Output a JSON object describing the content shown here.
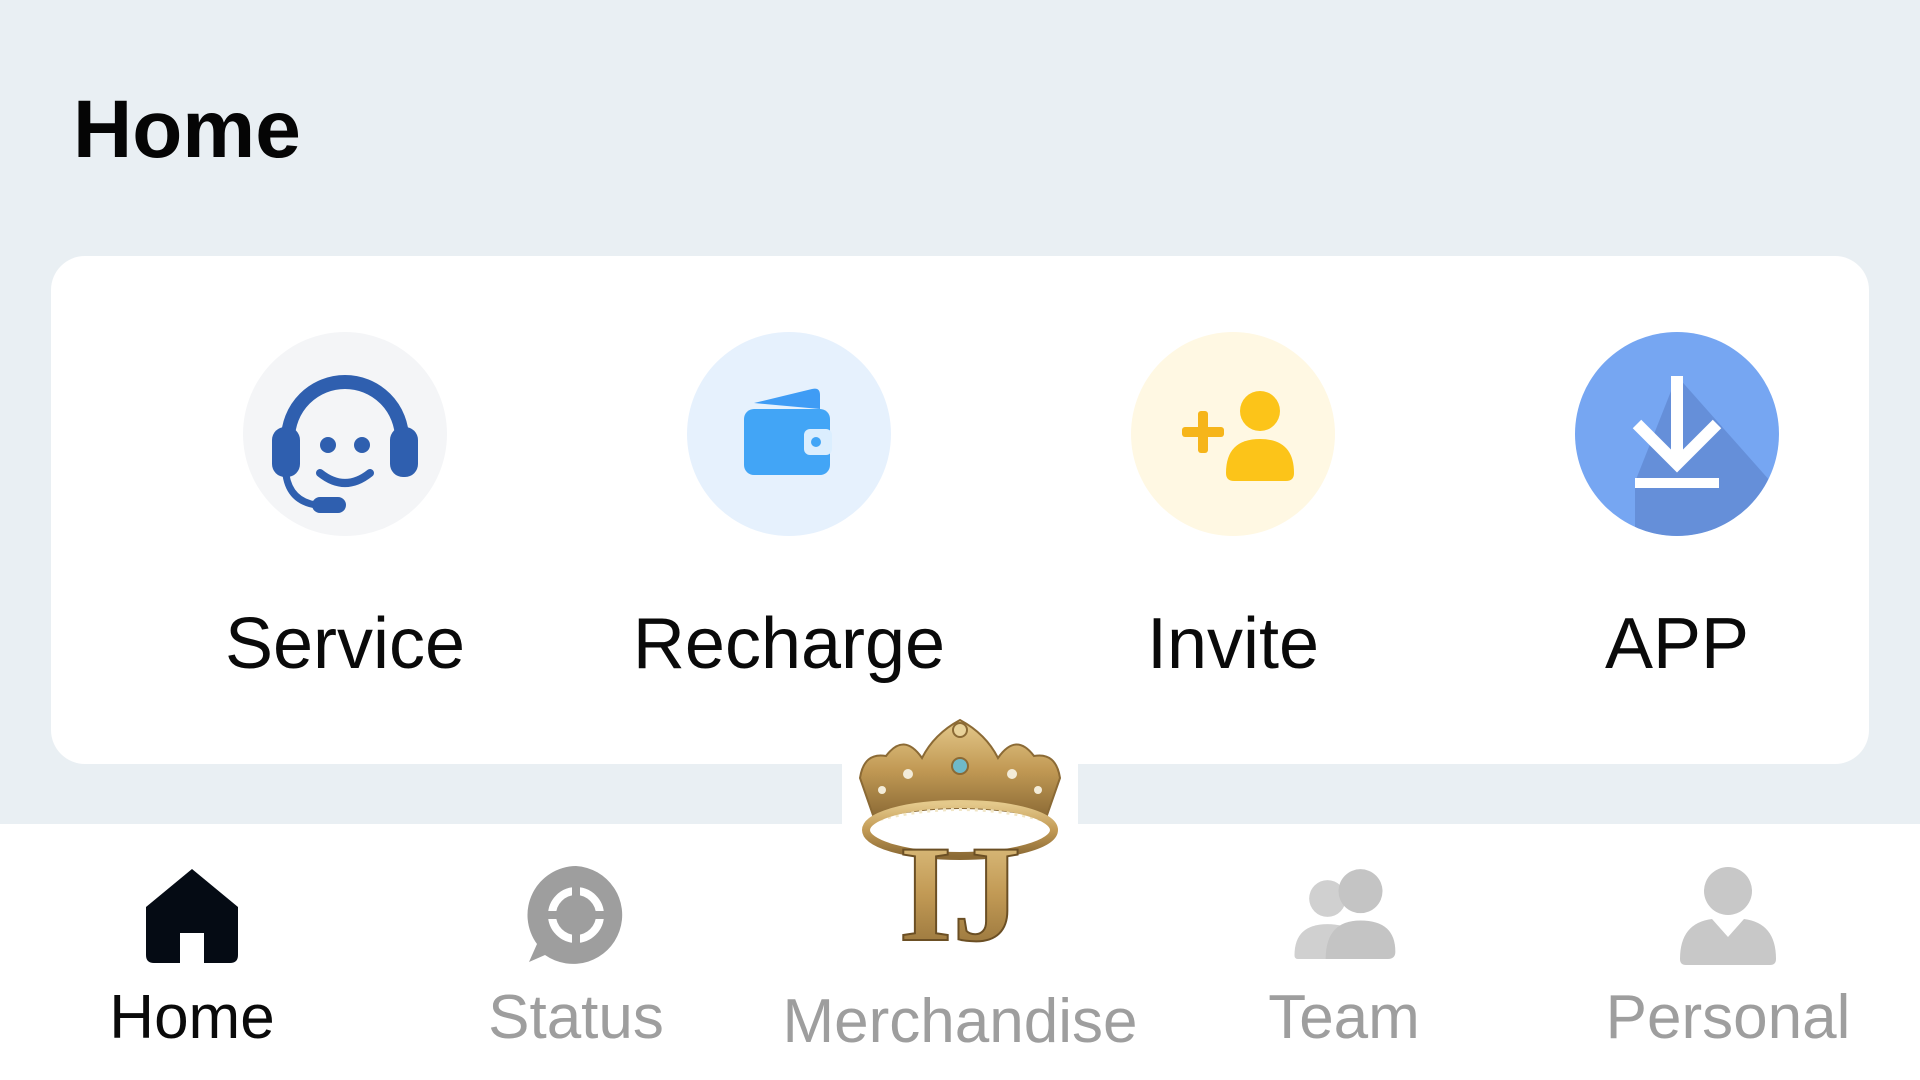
{
  "header": {
    "title": "Home"
  },
  "actions": [
    {
      "label": "Service",
      "icon": "headset-support-icon",
      "bg": "#f4f5f7",
      "color": "#2f5faf"
    },
    {
      "label": "Recharge",
      "icon": "wallet-icon",
      "bg": "#e6f1fd",
      "color": "#3f9cf5"
    },
    {
      "label": "Invite",
      "icon": "add-user-icon",
      "bg": "#fff8e3",
      "color": "#f9bf18"
    },
    {
      "label": "APP",
      "icon": "download-icon",
      "bg": "#76a6f2",
      "color": "#ffffff"
    }
  ],
  "nav": {
    "items": [
      {
        "label": "Home",
        "icon": "home-icon",
        "active": true
      },
      {
        "label": "Status",
        "icon": "status-chat-icon",
        "active": false
      },
      {
        "label": "Merchandise",
        "icon": "crown-logo-icon",
        "active": false
      },
      {
        "label": "Team",
        "icon": "team-icon",
        "active": false
      },
      {
        "label": "Personal",
        "icon": "person-icon",
        "active": false
      }
    ],
    "active_color": "#0a0a0a",
    "inactive_color": "#9e9e9e"
  },
  "logo": {
    "letters": "IJ"
  }
}
